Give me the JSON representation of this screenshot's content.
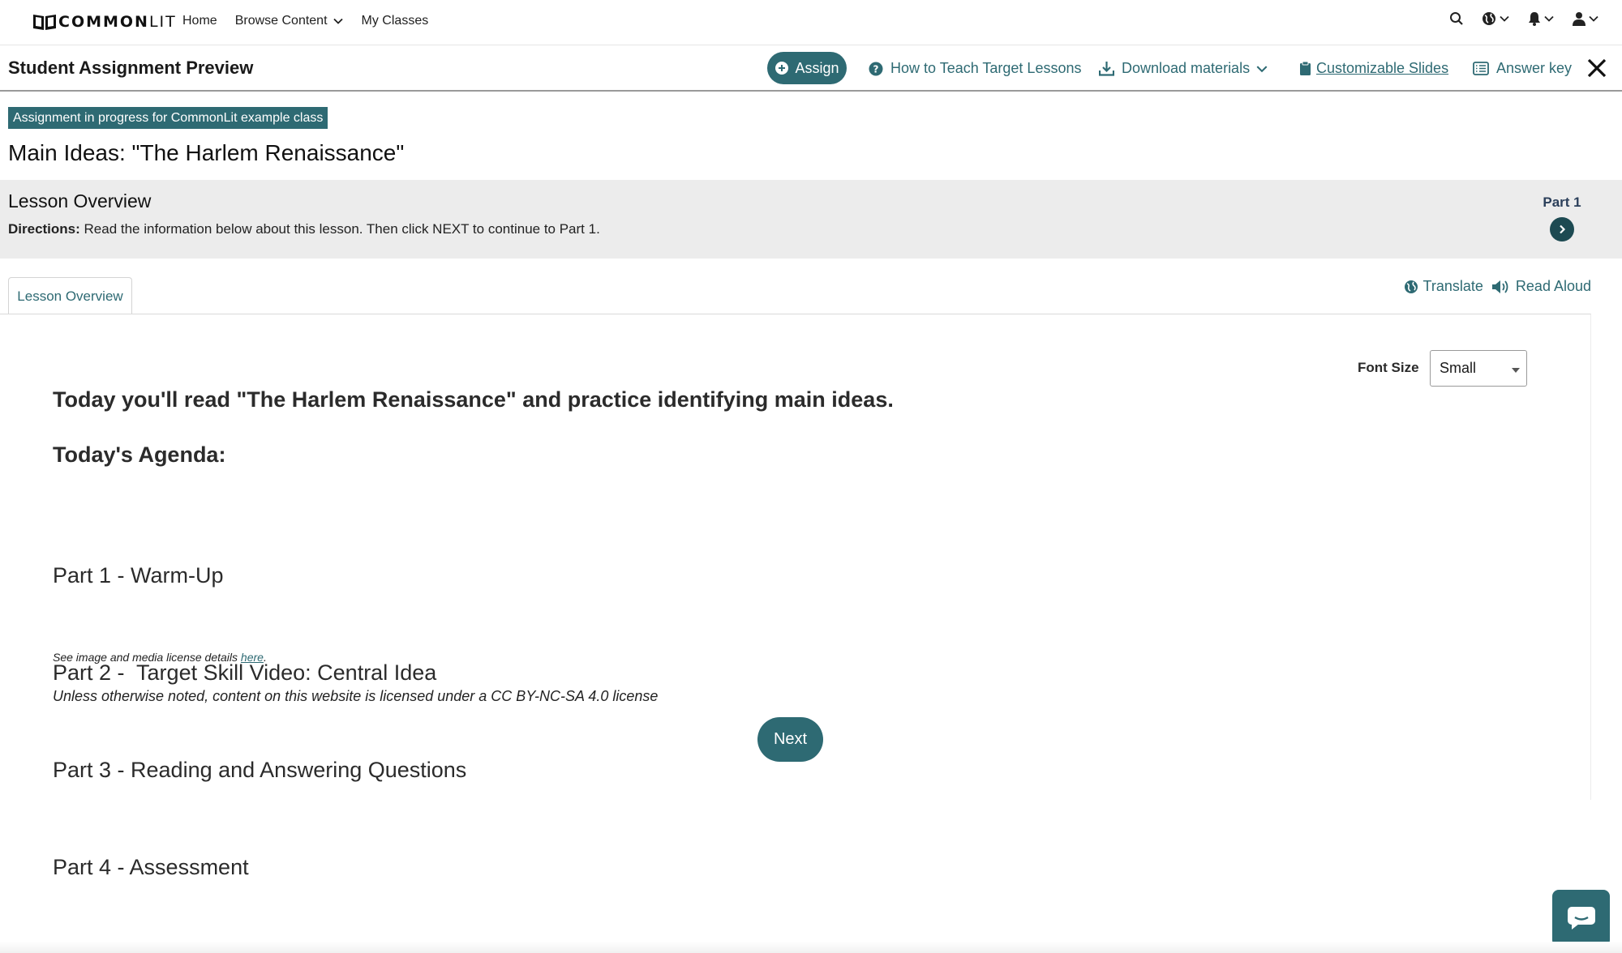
{
  "nav": {
    "logo_bold": "COMMON",
    "logo_light": "LIT",
    "links": [
      "Home",
      "Browse Content",
      "My Classes"
    ]
  },
  "header": {
    "title": "Student Assignment Preview",
    "assign_label": "Assign",
    "how_to_teach": "How to Teach Target Lessons",
    "download": "Download materials",
    "slides": "Customizable Slides",
    "answer_key": "Answer key"
  },
  "assignment": {
    "tag": "Assignment in progress for CommonLit example class",
    "lesson_title": "Main Ideas: \"The Harlem Renaissance\""
  },
  "overview": {
    "title": "Lesson Overview",
    "directions_label": "Directions:",
    "directions_text": " Read the information below about this lesson. Then click NEXT to continue to Part 1.",
    "part_label": "Part 1"
  },
  "tabs": {
    "active": "Lesson Overview"
  },
  "tools": {
    "translate": "Translate",
    "read_aloud": "Read Aloud"
  },
  "content": {
    "font_size_label": "Font Size",
    "font_size_value": "Small",
    "intro": "Today you'll read \"The Harlem Renaissance\" and practice identifying main ideas.",
    "agenda_heading": "Today's Agenda:",
    "agenda": [
      "Part 1 - Warm-Up",
      "Part 2 -  Target Skill Video: Central Idea",
      "Part 3 - Reading and Answering Questions",
      "Part 4 - Assessment"
    ],
    "license_prefix": "See image and media license details ",
    "license_link": "here",
    "license_suffix": ".",
    "license_note": "Unless otherwise noted, content on this website is licensed under a CC BY-NC-SA 4.0 license",
    "next_label": "Next"
  },
  "colors": {
    "accent": "#2e6a73",
    "overview_bg": "#ececec",
    "part_arrow": "#1d4a52"
  }
}
